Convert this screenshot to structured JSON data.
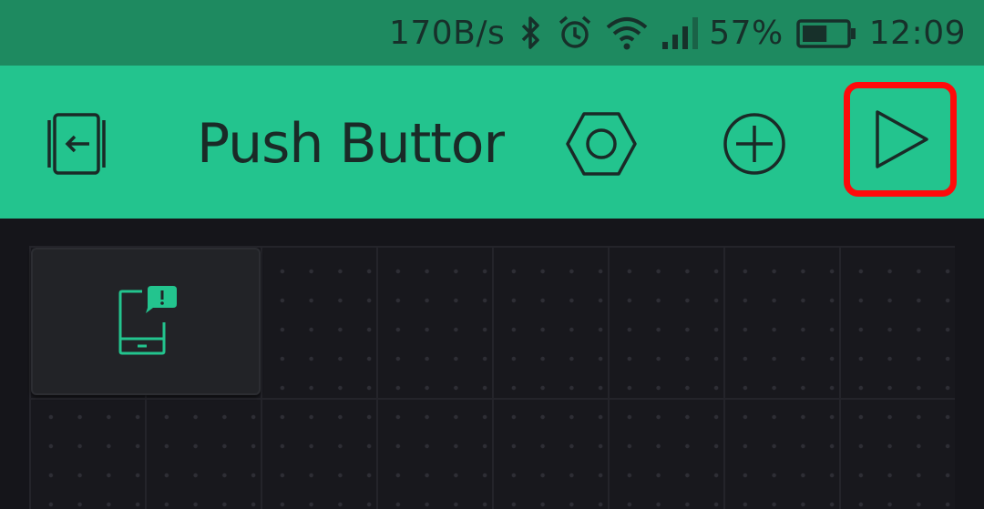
{
  "status_bar": {
    "net_speed": "170B/s",
    "battery_percent": "57%",
    "battery_level": 0.57,
    "time": "12:09",
    "icons": [
      "bluetooth-icon",
      "alarm-icon",
      "wifi-icon",
      "signal-icon",
      "battery-icon"
    ],
    "color": "#1e8a60"
  },
  "toolbar": {
    "title": "Push Buttor",
    "color": "#23c48e",
    "icons": [
      "exit-project-icon",
      "hexagon-settings-icon",
      "add-circle-icon",
      "play-icon"
    ],
    "highlight_color": "#ff0a0a"
  },
  "canvas": {
    "widgets": [
      {
        "type": "notification",
        "icon": "phone-notification-icon",
        "accent": "#23c48e"
      }
    ]
  }
}
